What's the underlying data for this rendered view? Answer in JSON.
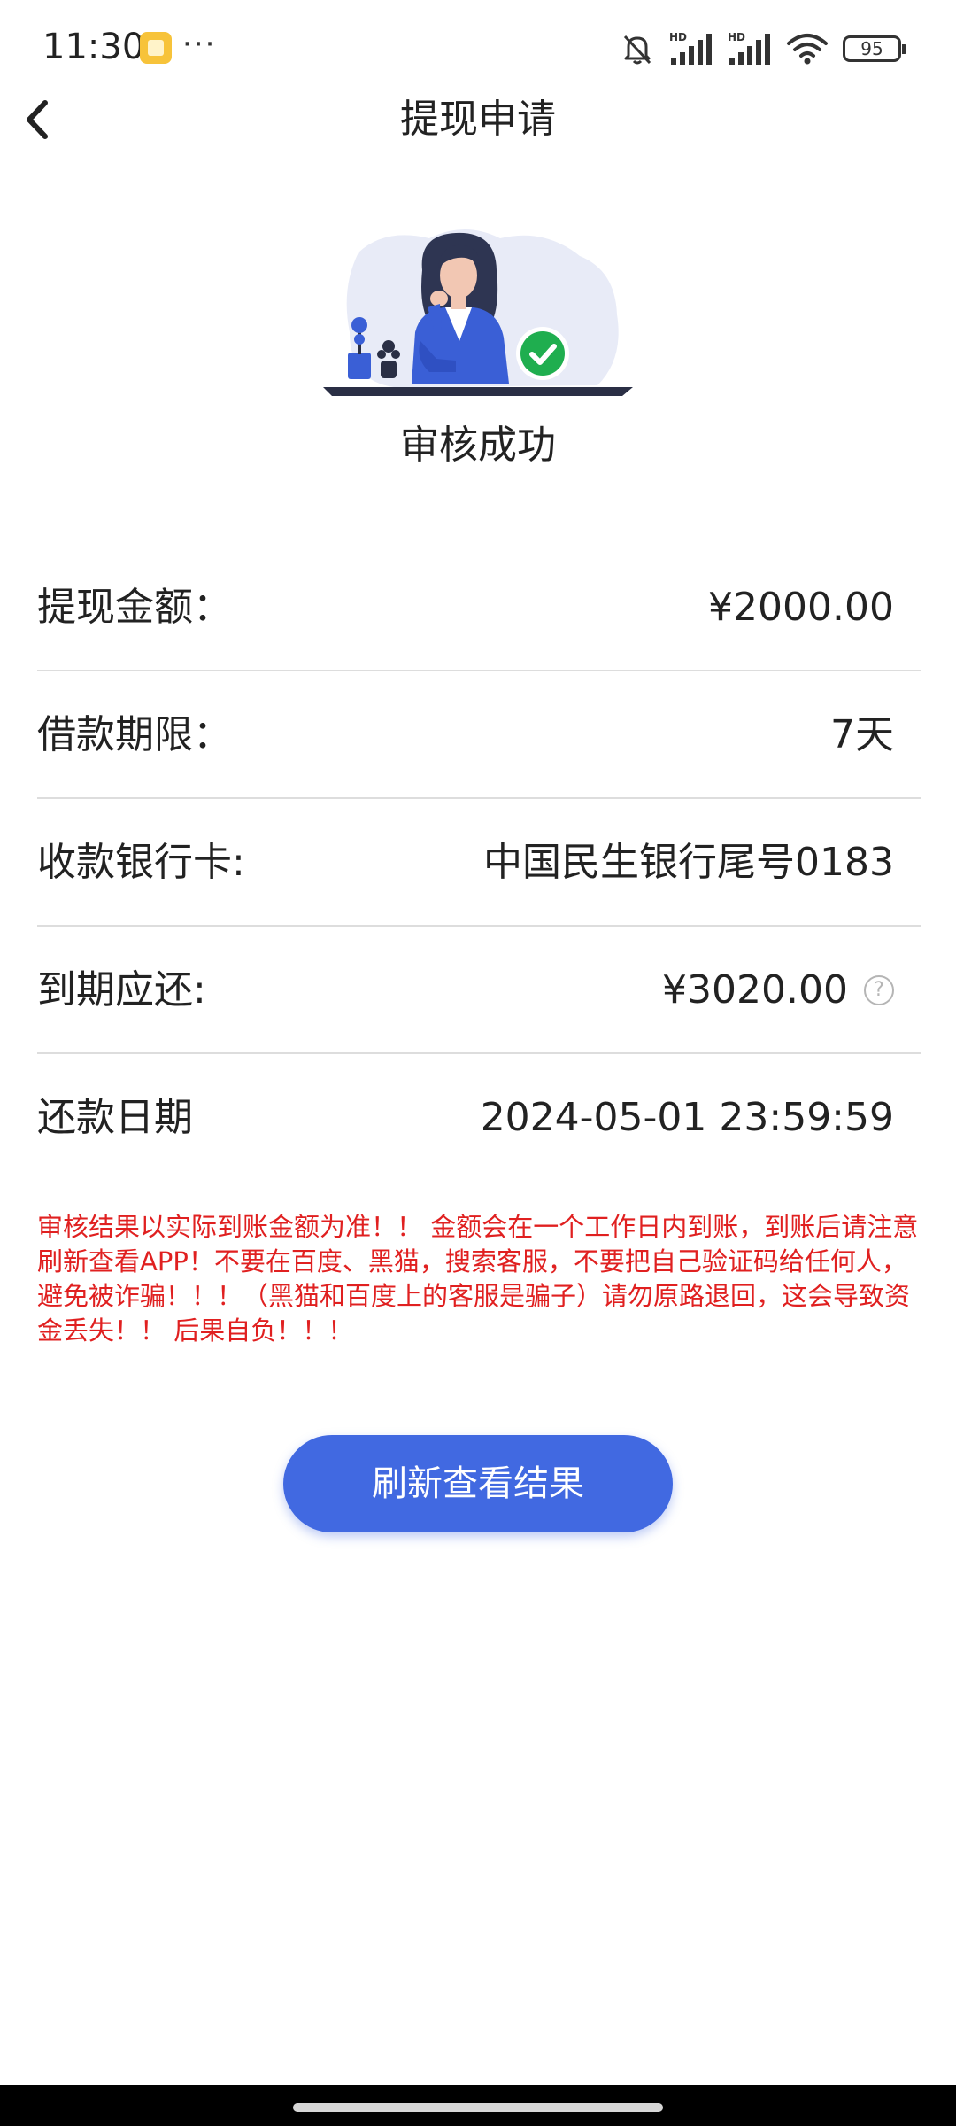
{
  "status_bar": {
    "time": "11:30",
    "more": "···",
    "battery": "95",
    "signal_tag": "HD"
  },
  "nav": {
    "title": "提现申请"
  },
  "result": {
    "status_text": "审核成功"
  },
  "info": [
    {
      "label": "提现金额：",
      "value": "¥2000.00"
    },
    {
      "label": "借款期限：",
      "value": "7天"
    },
    {
      "label": "收款银行卡:",
      "value": "中国民生银行尾号0183"
    },
    {
      "label": "到期应还:",
      "value": "¥3020.00"
    },
    {
      "label": "还款日期",
      "value": "2024-05-01 23:59:59"
    }
  ],
  "help_glyph": "?",
  "notice": "审核结果以实际到账金额为准！！ 金额会在一个工作日内到账，到账后请注意刷新查看APP！不要在百度、黑猫，搜索客服，不要把自己验证码给任何人，避免被诈骗！！！（黑猫和百度上的客服是骗子）请勿原路退回，这会导致资金丢失！！ 后果自负！！！",
  "button": {
    "refresh_label": "刷新查看结果"
  },
  "colors": {
    "accent": "#4169e1",
    "warning": "#e02020",
    "success": "#1fae4f"
  }
}
